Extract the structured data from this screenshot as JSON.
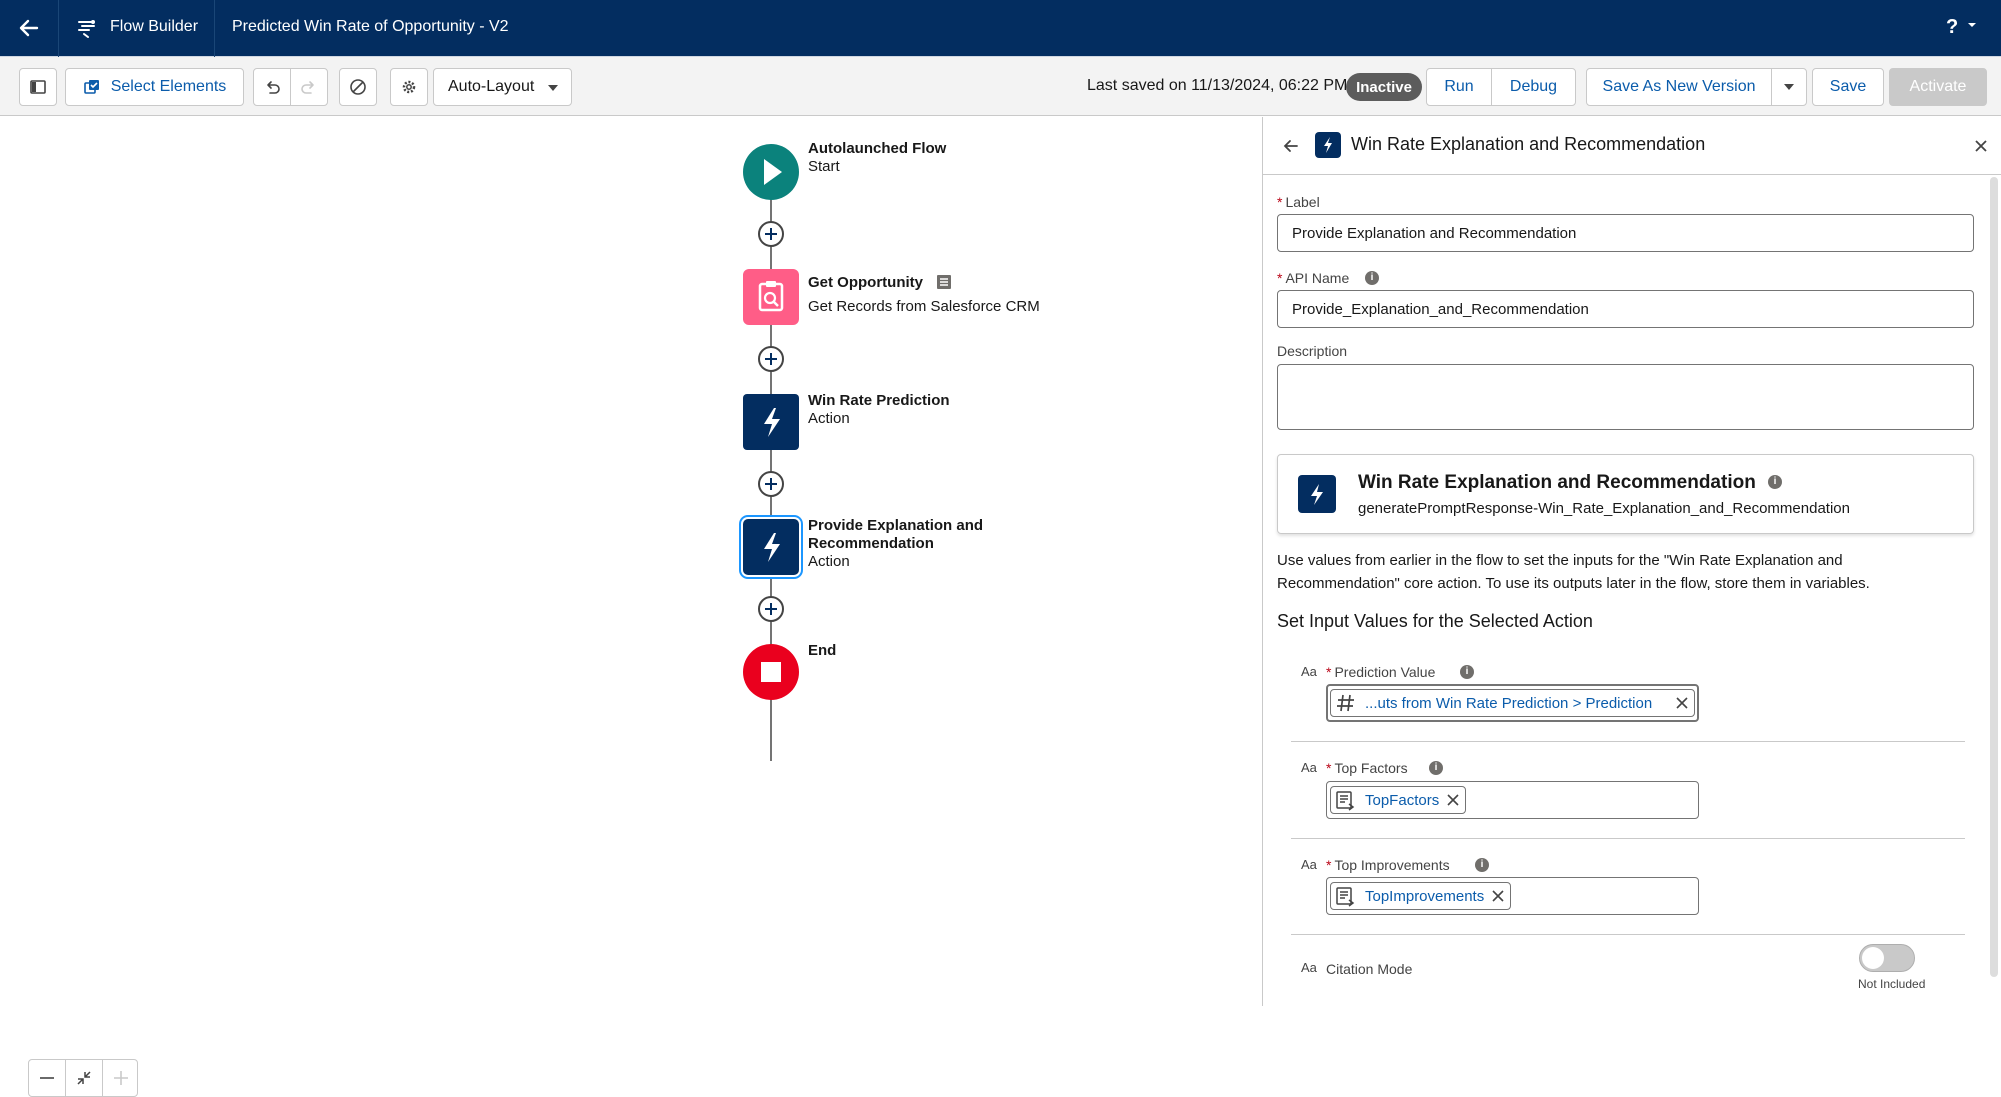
{
  "header": {
    "brand": "Flow Builder",
    "title": "Predicted Win Rate of Opportunity - V2",
    "help": "?"
  },
  "toolbar": {
    "select_elements": "Select Elements",
    "layout_select": "Auto-Layout",
    "last_saved": "Last saved on 11/13/2024, 06:22 PM",
    "status_badge": "Inactive",
    "run": "Run",
    "debug": "Debug",
    "save_as_new_version": "Save As New Version",
    "save": "Save",
    "activate": "Activate"
  },
  "canvas": {
    "nodes": [
      {
        "title": "Autolaunched Flow",
        "subtitle": "Start"
      },
      {
        "title": "Get Opportunity",
        "subtitle": "Get Records from Salesforce CRM"
      },
      {
        "title": "Win Rate Prediction",
        "subtitle": "Action"
      },
      {
        "title": "Provide Explanation and",
        "title2": "Recommendation",
        "subtitle": "Action"
      },
      {
        "title": "End",
        "subtitle": ""
      }
    ]
  },
  "panel": {
    "title": "Win Rate Explanation and Recommendation",
    "label_label": "Label",
    "label_value": "Provide Explanation and Recommendation",
    "api_name_label": "API Name",
    "api_name_value": "Provide_Explanation_and_Recommendation",
    "description_label": "Description",
    "action_card": {
      "title": "Win Rate Explanation and Recommendation",
      "api": "generatePromptResponse-Win_Rate_Explanation_and_Recommendation"
    },
    "help_text_1": "Use values from earlier in the flow to set the inputs for the \"Win Rate Explanation and",
    "help_text_2": "Recommendation\" core action. To use its outputs later in the flow, store them in variables.",
    "section_title": "Set Input Values for the Selected Action",
    "inputs": [
      {
        "label": "Prediction Value",
        "value": "...uts from Win Rate Prediction > Prediction"
      },
      {
        "label": "Top Factors",
        "value": "TopFactors"
      },
      {
        "label": "Top Improvements",
        "value": "TopImprovements"
      }
    ],
    "citation": {
      "label": "Citation Mode",
      "toggle_text": "Not Included",
      "enabled": false
    },
    "type_icon": "Aa"
  },
  "colors": {
    "header_bg": "#032d60",
    "start": "#0b827c",
    "get_records": "#ff5d87",
    "action": "#032d60",
    "end": "#ea001e",
    "link": "#0b5cab"
  }
}
